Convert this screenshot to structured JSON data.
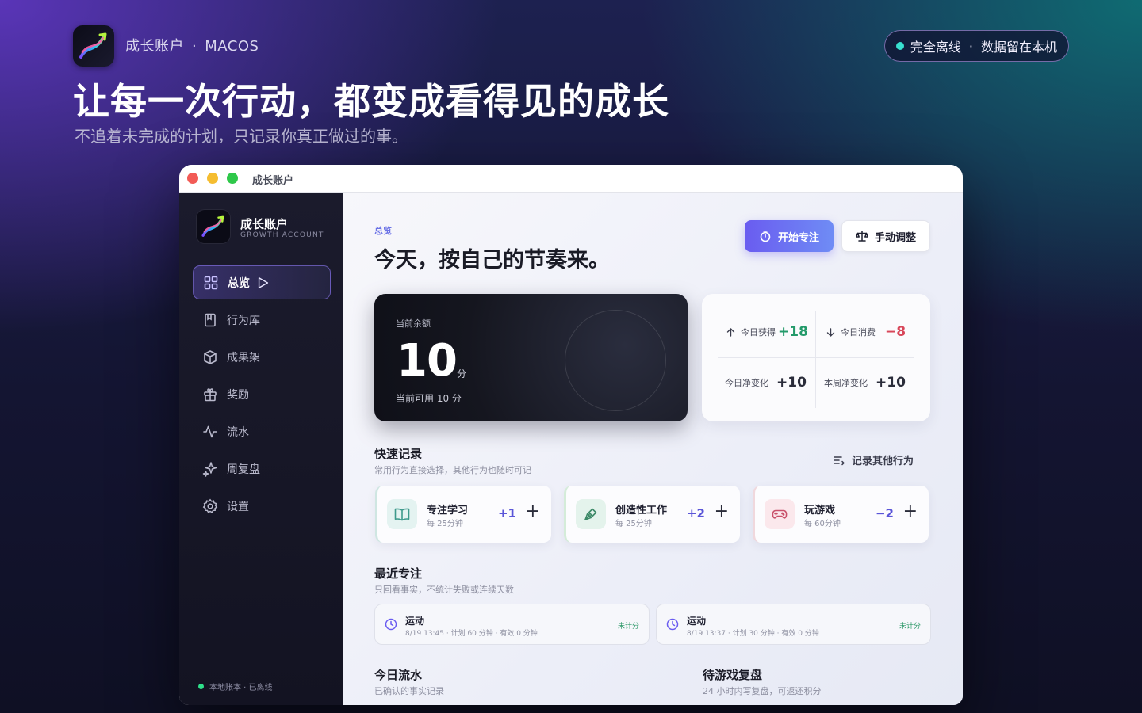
{
  "hero": {
    "brand_name": "成长账户",
    "brand_dot": "·",
    "platform": "MACOS",
    "offline_text": "完全离线",
    "offline_dot": "·",
    "offline_detail": "数据留在本机",
    "title": "让每一次行动，都变成看得见的成长",
    "subtitle": "不追着未完成的计划，只记录你真正做过的事。"
  },
  "window": {
    "title": "成长账户"
  },
  "sidebar": {
    "app_name": "成长账户",
    "app_subtitle": "GROWTH ACCOUNT",
    "items": [
      {
        "label": "总览",
        "icon": "grid-icon",
        "active": true
      },
      {
        "label": "行为库",
        "icon": "bookmark-icon",
        "active": false
      },
      {
        "label": "成果架",
        "icon": "box-icon",
        "active": false
      },
      {
        "label": "奖励",
        "icon": "gift-icon",
        "active": false
      },
      {
        "label": "流水",
        "icon": "activity-icon",
        "active": false
      },
      {
        "label": "周复盘",
        "icon": "sparkles-icon",
        "active": false
      },
      {
        "label": "设置",
        "icon": "gear-icon",
        "active": false
      }
    ],
    "status": "本地账本 · 已离线"
  },
  "main": {
    "eyebrow": "总览",
    "greeting": "今天，按自己的节奏来。",
    "btn_focus": "开始专注",
    "btn_adjust": "手动调整",
    "balance": {
      "label": "当前余额",
      "value": "10",
      "unit": "分",
      "available": "当前可用 10 分"
    },
    "stats": {
      "earned_label": "今日获得",
      "earned_value": "+18",
      "spent_label": "今日消费",
      "spent_value": "−8",
      "day_net_label": "今日净变化",
      "day_net_value": "+10",
      "week_net_label": "本周净变化",
      "week_net_value": "+10"
    },
    "quick": {
      "title": "快速记录",
      "subtitle": "常用行为直接选择，其他行为也随时可记",
      "link": "记录其他行为",
      "cards": [
        {
          "title": "专注学习",
          "sub": "每 25分钟",
          "delta": "+1",
          "plus": "+",
          "icon": "book-icon"
        },
        {
          "title": "创造性工作",
          "sub": "每 25分钟",
          "delta": "+2",
          "plus": "+",
          "icon": "pen-icon"
        },
        {
          "title": "玩游戏",
          "sub": "每 60分钟",
          "delta": "−2",
          "plus": "+",
          "icon": "gamepad-icon"
        }
      ]
    },
    "recent": {
      "title": "最近专注",
      "subtitle": "只回看事实，不统计失败或连续天数",
      "items": [
        {
          "title": "运动",
          "meta": "8/19 13:45 · 计划 60 分钟 · 有效 0 分钟",
          "status": "未计分"
        },
        {
          "title": "运动",
          "meta": "8/19 13:37 · 计划 30 分钟 · 有效 0 分钟",
          "status": "未计分"
        }
      ]
    },
    "today_flow": {
      "title": "今日流水",
      "subtitle": "已确认的事实记录"
    },
    "game_review": {
      "title": "待游戏复盘",
      "subtitle": "24 小时内写复盘，可返还积分"
    }
  },
  "colors": {
    "accent": "#6a5cf0",
    "positive": "#239a6a",
    "negative": "#d8475a",
    "online": "#38e0d0"
  }
}
